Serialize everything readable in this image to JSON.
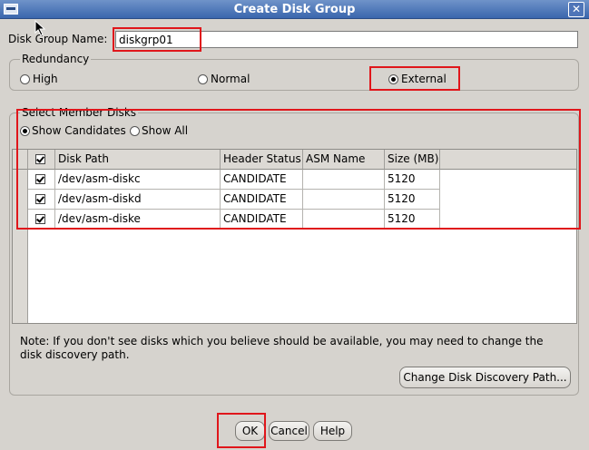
{
  "window": {
    "title": "Create Disk Group",
    "close_glyph": "✕"
  },
  "disk_group_name": {
    "label": "Disk Group Name:",
    "value": "diskgrp01"
  },
  "redundancy": {
    "legend": "Redundancy",
    "options": [
      {
        "label": "High",
        "selected": false
      },
      {
        "label": "Normal",
        "selected": false
      },
      {
        "label": "External",
        "selected": true
      }
    ]
  },
  "member_disks": {
    "legend": "Select Member Disks",
    "filters": [
      {
        "label": "Show Candidates",
        "selected": true
      },
      {
        "label": "Show All",
        "selected": false
      }
    ],
    "columns": [
      "Disk Path",
      "Header Status",
      "ASM Name",
      "Size (MB)"
    ],
    "rows": [
      {
        "checked": true,
        "disk_path": "/dev/asm-diskc",
        "header_status": "CANDIDATE",
        "asm_name": "",
        "size_mb": "5120"
      },
      {
        "checked": true,
        "disk_path": "/dev/asm-diskd",
        "header_status": "CANDIDATE",
        "asm_name": "",
        "size_mb": "5120"
      },
      {
        "checked": true,
        "disk_path": "/dev/asm-diske",
        "header_status": "CANDIDATE",
        "asm_name": "",
        "size_mb": "5120"
      }
    ],
    "note": "Note: If you don't see disks which you believe should be available, you may need to change the disk discovery path.",
    "change_path_button": "Change Disk Discovery Path..."
  },
  "buttons": {
    "ok": "OK",
    "cancel": "Cancel",
    "help": "Help"
  },
  "colors": {
    "highlight": "#e0161b",
    "title_bar": "#3a66ad",
    "background": "#d6d3ce"
  }
}
